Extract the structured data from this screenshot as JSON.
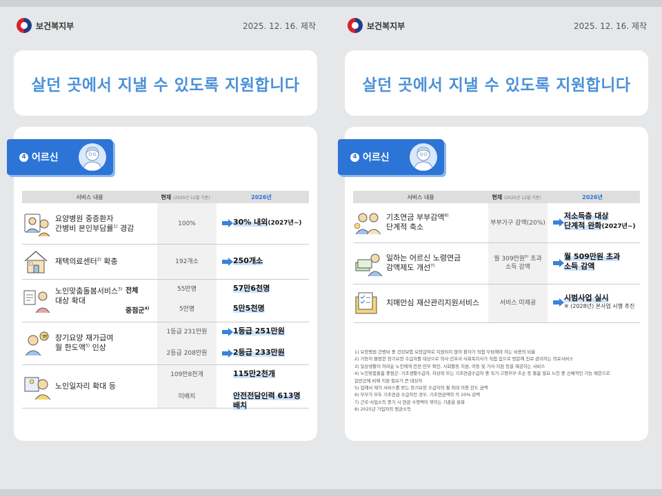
{
  "header": {
    "ministry": "보건복지부",
    "date": "2025. 12. 16. 제작"
  },
  "title": "살던 곳에서 지낼 수 있도록 지원합니다",
  "section": {
    "number": "4",
    "label": "어르신"
  },
  "table_header": {
    "service": "서비스 내용",
    "current": "현재",
    "current_note": "(2025년 12월 기준)",
    "next": "2026년"
  },
  "left_rows": [
    {
      "service": "요양병원 중증환자",
      "service2": "간병비 본인부담률",
      "sup": "1)",
      "service3": " 경감",
      "current": "100%",
      "new": "30% 내외",
      "new_note": "(2027년~)"
    },
    {
      "service": "재택의료센터",
      "sup": "2)",
      "service3": " 확충",
      "current": "192개소",
      "new": "250개소"
    },
    {
      "service": "노인맞춤돌봄서비스",
      "sup": "3)",
      "service2": "대상 확대",
      "sub1": "전체",
      "sub2": "중점군",
      "sub2_sup": "4)",
      "current1": "55만명",
      "current2": "5만명",
      "new1": "57만6천명",
      "new2": "5만5천명"
    },
    {
      "service": "장기요양 재가급여",
      "service2": "월 한도액",
      "sup": "5)",
      "service3": " 인상",
      "current1": "1등급  231만원",
      "current2": "2등급  208만원",
      "new1": "1등급   251만원",
      "new2": "2등급  233만원"
    },
    {
      "service": "노인일자리 확대 등",
      "current1": "109만8천개",
      "current2": "미배치",
      "new1": "115만2천개",
      "new2": "안전전담인력 613명 배치"
    }
  ],
  "right_rows": [
    {
      "service": "기초연금 부부감액",
      "sup": "6)",
      "service2": "단계적 축소",
      "current": "부부가구 감액(20%)",
      "new": "저소득층 대상",
      "new_b": "단계적 완화",
      "new_note": "(2027년~)"
    },
    {
      "service": "일하는 어르신 노령연금",
      "service2": "감액제도 개선",
      "sup": "7)",
      "current": "월 309만원",
      "current_sup": "8)",
      "current_b": " 초과",
      "current2": "소득 감액",
      "new": "월 509만원 초과",
      "new_b": "소득 감액"
    },
    {
      "service": "치매안심 재산관리지원서비스",
      "current": "서비스 미제공",
      "new": "시범사업 실시",
      "new_note": "※ (2028년) 본사업 시행 추진"
    }
  ],
  "notes": [
    "1) 요양병원 간병비 중 건강보험 요양급여로 지원되지 않아 환자가 직접 부담해야 하는 비용의 비율",
    "2) 거동이 불편한 장기요양 수급자를 대상으로 의사·간호사·사회복지사가 직접 집으로 방문해 진료·관리하는 의료서비스",
    "3) 일상생활이 어려운 노인에게 안전·안부 확인, 사회활동 지원, 이동 및 가사 지원 등을 제공하는 서비스",
    "4) 노인맞춤돌봄 중점군: 기초생활수급자, 차상위 또는 기초연금수급자 중 독거·고령부부·조손 등 돌봄 필요 노인 중 신체적인 기능 제한으로",
    "   일반군에 비해 지원 필요가 큰 대상자",
    "5) 집에서 재가 서비스를 받는 장기요양 수급자의 월 최대 이용 한도 금액",
    "6) 부부가 모두 기초연금 수급자인 경우, 기초연금액의 각 20% 감액",
    "7) 근로·사업소득 증가 시 연금 수령액이 깎이는 기준을 완화",
    "8) 2025년 가입자의 평균소득"
  ]
}
